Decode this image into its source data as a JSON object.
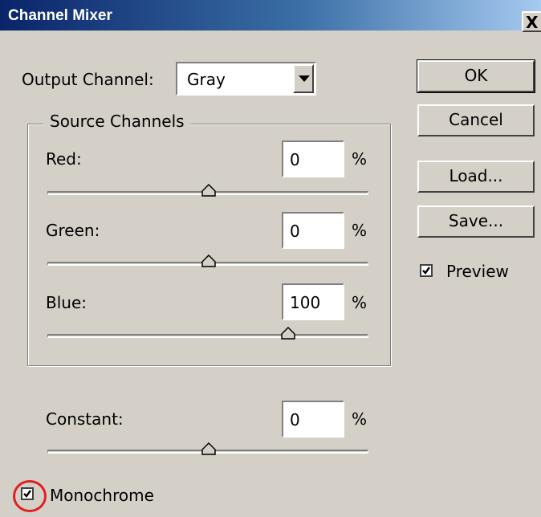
{
  "window": {
    "title": "Channel Mixer",
    "close_glyph": "X"
  },
  "output_channel": {
    "label": "Output Channel:",
    "value": "Gray"
  },
  "source_channels": {
    "legend": "Source Channels",
    "red": {
      "label": "Red:",
      "value": "0",
      "unit": "%",
      "slider_percent": 0
    },
    "green": {
      "label": "Green:",
      "value": "0",
      "unit": "%",
      "slider_percent": 0
    },
    "blue": {
      "label": "Blue:",
      "value": "100",
      "unit": "%",
      "slider_percent": 100
    }
  },
  "constant": {
    "label": "Constant:",
    "value": "0",
    "unit": "%",
    "slider_percent": 0
  },
  "buttons": {
    "ok": "OK",
    "cancel": "Cancel",
    "load": "Load...",
    "save": "Save..."
  },
  "preview": {
    "label": "Preview",
    "checked": true
  },
  "monochrome": {
    "label": "Monochrome",
    "checked": true
  },
  "colors": {
    "annotation_circle": "#e02020",
    "dialog_bg": "#d4d0c8"
  }
}
